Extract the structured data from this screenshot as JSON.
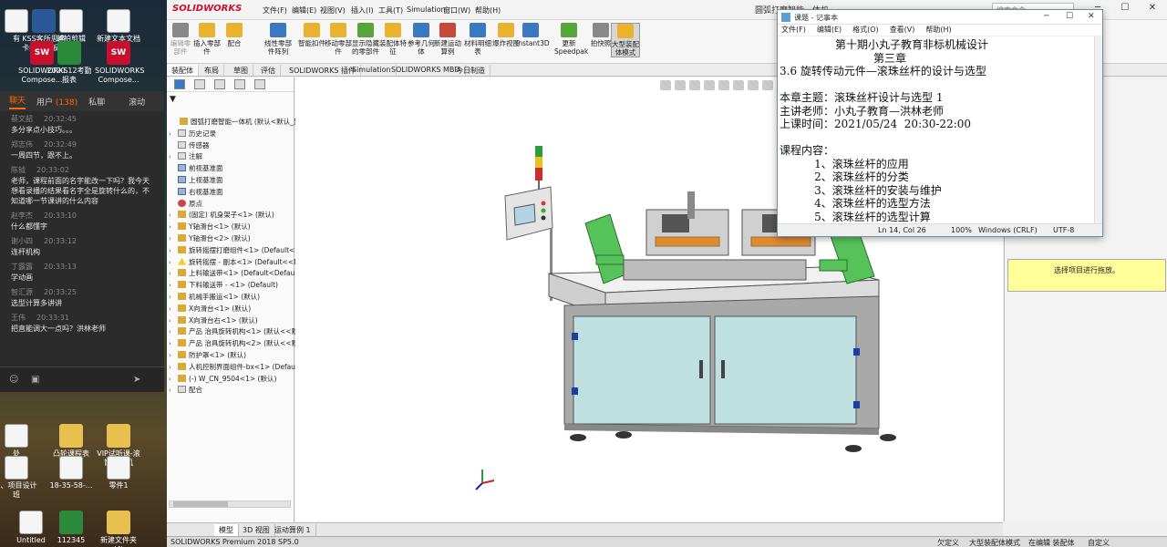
{
  "desktop": {
    "icons": [
      {
        "label": "有",
        "kind": "doc"
      },
      {
        "label": "KSS客所思声卡控制面板...",
        "kind": "word"
      },
      {
        "label": "越拍剪辑",
        "kind": "doc"
      },
      {
        "label": "新建文本文档 (9)",
        "kind": "doc"
      },
      {
        "label": "SOLIDWORKS Compose...",
        "kind": "sw"
      },
      {
        "label": "2020.12考勤报表",
        "kind": "excel"
      },
      {
        "label": "SOLIDWORKS Compose...",
        "kind": "sw"
      },
      {
        "label": "处",
        "kind": "doc"
      },
      {
        "label": "凸轮课程表",
        "kind": "folder"
      },
      {
        "label": "VIP试听课-滚筒输送机",
        "kind": "folder"
      },
      {
        "label": "3、项目设计班",
        "kind": "doc"
      },
      {
        "label": "18-35-58-...",
        "kind": "doc"
      },
      {
        "label": "零件1",
        "kind": "doc"
      },
      {
        "label": "Untitled",
        "kind": "doc"
      },
      {
        "label": "112345",
        "kind": "excel"
      },
      {
        "label": "新建文件夹 (4)",
        "kind": "folder"
      }
    ]
  },
  "chat": {
    "tabs": {
      "chat": "聊天",
      "users": "用户",
      "user_count": "(138)",
      "private": "私聊",
      "recent": "滚动"
    },
    "messages": [
      {
        "name": "蔡文韶",
        "time": "20:32:45",
        "text": "多分享点小技巧。。。"
      },
      {
        "name": "郑志伟",
        "time": "20:32:49",
        "text": "一周四节，跟不上。"
      },
      {
        "name": "陈钺",
        "time": "20:33:02",
        "text": "老师，课程前面的名字能改一下吗？我今天想看录播的结果看名字全是旋转什么的，不知道哪一节课讲的什么内容"
      },
      {
        "name": "赵李杰",
        "time": "20:33:10",
        "text": "什么都懂字"
      },
      {
        "name": "谢小四",
        "time": "20:33:12",
        "text": "连杆机构"
      },
      {
        "name": "丁露露",
        "time": "20:33:13",
        "text": "学动画"
      },
      {
        "name": "智汇源",
        "time": "20:33:25",
        "text": "选型计算多讲讲"
      },
      {
        "name": "王伟",
        "time": "20:33:31",
        "text": "把直能调大一点吗？洪林老师"
      }
    ]
  },
  "sw": {
    "logo": "SOLIDWORKS",
    "menus": [
      "文件(F)",
      "编辑(E)",
      "视图(V)",
      "插入(I)",
      "工具(T)",
      "Simulation",
      "窗口(W)",
      "帮助(H)"
    ],
    "doc_title": "圆弧打磨智能一体机...",
    "search_placeholder": "搜索命令",
    "ribbon": [
      {
        "label": "编辑零部件",
        "dim": true
      },
      {
        "label": "插入零部件"
      },
      {
        "label": "配合"
      },
      {
        "label": "线性零部件阵列"
      },
      {
        "label": "智能扣件"
      },
      {
        "label": "移动零部件"
      },
      {
        "label": "显示隐藏的零部件"
      },
      {
        "label": "装配体特征"
      },
      {
        "label": "参考几何体"
      },
      {
        "label": "新建运动算例"
      },
      {
        "label": "材料明细表"
      },
      {
        "label": "爆炸视图"
      },
      {
        "label": "Instant3D"
      },
      {
        "label": "更新Speedpak"
      },
      {
        "label": "拍快照"
      },
      {
        "label": "大型装配体模式",
        "highlight": true
      }
    ],
    "tabs": [
      "装配体",
      "布局",
      "草图",
      "评估",
      "SOLIDWORKS 插件",
      "Simulation",
      "SOLIDWORKS MBD",
      "今日制造"
    ],
    "active_tab": "装配体",
    "tree": [
      {
        "label": "圆弧打磨智能一体机 (默认<默认_显示状态-1>)",
        "icon": "asm",
        "indent": 0,
        "expand": ""
      },
      {
        "label": "历史记录",
        "icon": "fold",
        "indent": 1,
        "expand": "›"
      },
      {
        "label": "传感器",
        "icon": "fold",
        "indent": 1,
        "expand": ""
      },
      {
        "label": "注解",
        "icon": "fold",
        "indent": 1,
        "expand": "›"
      },
      {
        "label": "前视基准面",
        "icon": "plane",
        "indent": 1,
        "expand": ""
      },
      {
        "label": "上视基准面",
        "icon": "plane",
        "indent": 1,
        "expand": ""
      },
      {
        "label": "右视基准面",
        "icon": "plane",
        "indent": 1,
        "expand": ""
      },
      {
        "label": "原点",
        "icon": "org",
        "indent": 1,
        "expand": ""
      },
      {
        "label": "(固定) 机身架子<1> (默认)",
        "icon": "asm",
        "indent": 1,
        "expand": "›"
      },
      {
        "label": "Y轴滑台<1> (默认)",
        "icon": "asm",
        "indent": 1,
        "expand": "›"
      },
      {
        "label": "Y轴滑台<2> (默认)",
        "icon": "asm",
        "indent": 1,
        "expand": "›"
      },
      {
        "label": "旋转摇摆打磨组件<1> (Default<<Default>",
        "icon": "asm",
        "indent": 1,
        "expand": "›"
      },
      {
        "label": "旋转摇摆 - 副本<1> (Default<<Default>",
        "icon": "warn",
        "indent": 1,
        "expand": "›"
      },
      {
        "label": "上料输送带<1> (Default<Default_",
        "icon": "asm",
        "indent": 1,
        "expand": "›"
      },
      {
        "label": "下料输送带 - <1> (Default)",
        "icon": "asm",
        "indent": 1,
        "expand": "›"
      },
      {
        "label": "机械手搬运<1> (默认)",
        "icon": "asm",
        "indent": 1,
        "expand": "›"
      },
      {
        "label": "X向滑台<1> (默认)",
        "icon": "asm",
        "indent": 1,
        "expand": "›"
      },
      {
        "label": "X向滑台右<1> (默认)",
        "icon": "asm",
        "indent": 1,
        "expand": "›"
      },
      {
        "label": "产品 治具旋转机构<1> (默认<<默认",
        "icon": "asm",
        "indent": 1,
        "expand": "›"
      },
      {
        "label": "产品 治具旋转机构<2> (默认<<默认",
        "icon": "asm",
        "indent": 1,
        "expand": "›"
      },
      {
        "label": "防护罩<1> (默认)",
        "icon": "asm",
        "indent": 1,
        "expand": "›"
      },
      {
        "label": "人机控制界面组件-bx<1> (Default",
        "icon": "asm",
        "indent": 1,
        "expand": "›"
      },
      {
        "label": "(-) W_CN_9504<1> (默认)",
        "icon": "asm",
        "indent": 1,
        "expand": "›"
      },
      {
        "label": "配合",
        "icon": "fold",
        "indent": 1,
        "expand": "›"
      }
    ],
    "model_tabs": [
      "模型",
      "3D 视图",
      "运动算例 1"
    ],
    "active_model_tab": "模型",
    "status_left": "SOLIDWORKS Premium 2018 SP5.0",
    "status_right": [
      "欠定义",
      "大型装配体模式",
      "在编辑 装配体",
      "自定义"
    ],
    "task_hint": "选择项目进行拖放。"
  },
  "notepad": {
    "title": "课题 - 记事本",
    "menus": [
      "文件(F)",
      "编辑(E)",
      "格式(O)",
      "查看(V)",
      "帮助(H)"
    ],
    "lines": [
      "                第十期小丸子教育非标机械设计",
      "                           第三章",
      "3.6 旋转传动元件—滚珠丝杆的设计与选型",
      "",
      "本章主题：滚珠丝杆设计与选型 1",
      "主讲老师：小丸子教育—洪林老师",
      "上课时间：2021/05/24  20:30-22:00",
      "",
      "课程内容：",
      "          1、滚珠丝杆的应用",
      "          2、滚珠丝杆的分类",
      "          3、滚珠丝杆的安装与维护",
      "          4、滚珠丝杆的选型方法",
      "          5、滚珠丝杆的选型计算"
    ],
    "status": {
      "position": "Ln 14, Col 26",
      "zoom": "100%",
      "eol": "Windows (CRLF)",
      "encoding": "UTF-8"
    }
  }
}
